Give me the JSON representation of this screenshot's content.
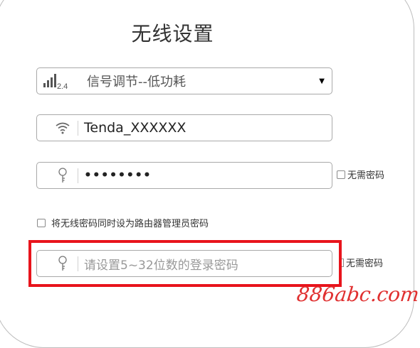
{
  "page": {
    "title": "无线设置"
  },
  "signal": {
    "band_label": "2.4",
    "selected": "信号调节--低功耗"
  },
  "ssid": {
    "value": "Tenda_XXXXXX"
  },
  "wifi_password": {
    "value": "••••••••",
    "no_password_label": "无需密码"
  },
  "sync_admin": {
    "label": "将无线密码同时设为路由器管理员密码"
  },
  "admin_password": {
    "placeholder": "请设置5~32位数的登录密码",
    "no_password_label": "无需密码"
  },
  "watermark": {
    "text": "886abc.com"
  },
  "colors": {
    "highlight": "#e8141c",
    "watermark": "#e03030"
  },
  "icons": {
    "signal": "signal-strength-icon",
    "wifi": "wifi-icon",
    "key": "key-icon"
  }
}
